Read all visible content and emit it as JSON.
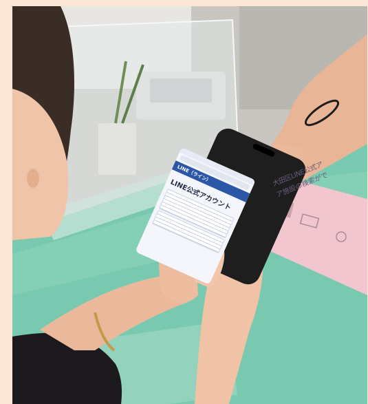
{
  "photo": {
    "phone": {
      "banner": "LINE（ライン）",
      "title": "LINE公式アカウント"
    },
    "leaflet": {
      "title": "大田区LINE公式ア",
      "subtitle": "ア施設の検索がで"
    }
  }
}
